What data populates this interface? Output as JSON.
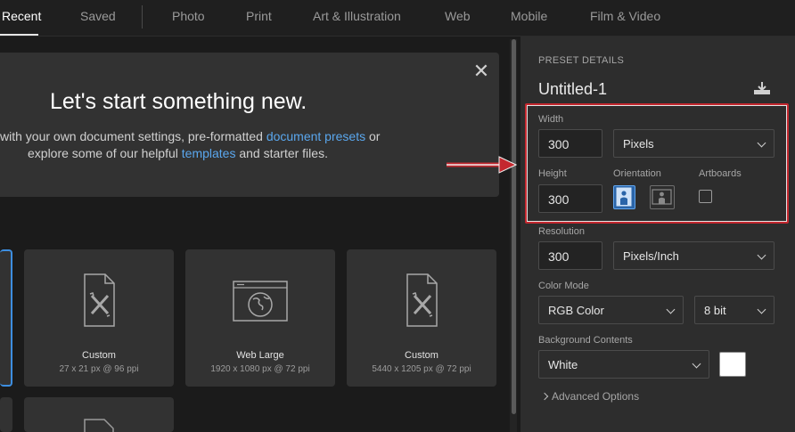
{
  "tabs": [
    {
      "label": "Recent"
    },
    {
      "label": "Saved"
    },
    {
      "label": "Photo"
    },
    {
      "label": "Print"
    },
    {
      "label": "Art & Illustration"
    },
    {
      "label": "Web"
    },
    {
      "label": "Mobile"
    },
    {
      "label": "Film & Video"
    }
  ],
  "welcome": {
    "title": "Let's start something new.",
    "line1_pre": "with your own document settings, pre-formatted ",
    "line1_link": "document presets",
    "line1_post": " or",
    "line2_pre": "explore some of our helpful ",
    "line2_link": "templates",
    "line2_post": " and starter files."
  },
  "cards": [
    {
      "title": "Custom",
      "subtitle": "27 x 21 px @ 96 ppi",
      "icon": "custom-doc-icon"
    },
    {
      "title": "Web Large",
      "subtitle": "1920 x 1080 px @ 72 ppi",
      "icon": "web-globe-icon"
    },
    {
      "title": "Custom",
      "subtitle": "5440 x 1205 px @ 72 ppi",
      "icon": "custom-doc-icon"
    }
  ],
  "preset": {
    "section_label": "PRESET DETAILS",
    "name": "Untitled-1",
    "width_label": "Width",
    "width_value": "300",
    "width_unit": "Pixels",
    "height_label": "Height",
    "height_value": "300",
    "orientation_label": "Orientation",
    "artboards_label": "Artboards",
    "resolution_label": "Resolution",
    "resolution_value": "300",
    "resolution_unit": "Pixels/Inch",
    "color_mode_label": "Color Mode",
    "color_mode": "RGB Color",
    "bit_depth": "8 bit",
    "background_label": "Background Contents",
    "background": "White",
    "advanced": "Advanced Options"
  },
  "colors": {
    "accent": "#5aa7ee",
    "highlight": "#c4282f"
  }
}
